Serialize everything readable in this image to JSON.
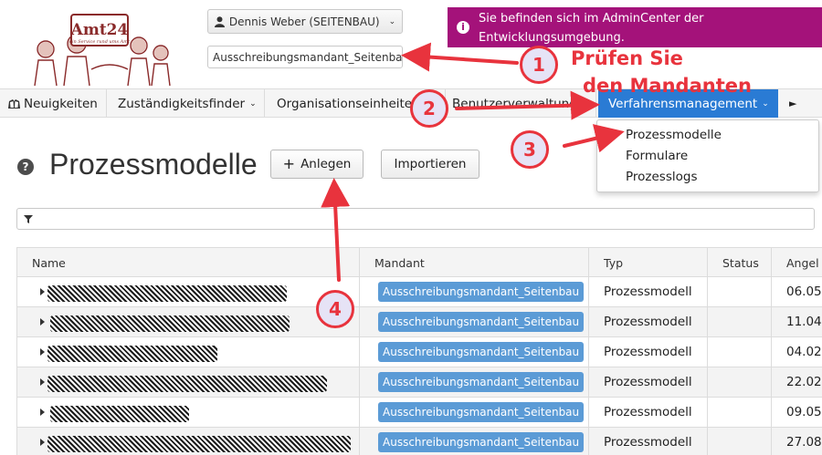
{
  "header": {
    "user_button": "Dennis Weber (SEITENBAU)",
    "mandant_select": "Ausschreibungsmandant_Seitenbau",
    "banner_text": "Sie befinden sich im AdminCenter der Entwicklungsumgebung.",
    "logo_text": "Amt24",
    "logo_tagline": "ein Service rund ums Amt"
  },
  "nav": {
    "items": [
      {
        "label": "Neuigkeiten"
      },
      {
        "label": "Zuständigkeitsfinder"
      },
      {
        "label": "Organisationseinheiten"
      },
      {
        "label": "Benutzerverwaltung"
      },
      {
        "label": "Verfahrensmanagement"
      }
    ],
    "more_symbol": "►"
  },
  "dropdown": {
    "items": [
      "Prozessmodelle",
      "Formulare",
      "Prozesslogs"
    ]
  },
  "page": {
    "title": "Prozessmodelle",
    "add_button": "Anlegen",
    "import_button": "Importieren"
  },
  "table": {
    "columns": [
      "Name",
      "Mandant",
      "Typ",
      "Status",
      "Angel"
    ],
    "rows": [
      {
        "mandant": "Ausschreibungsmandant_Seitenbau",
        "typ": "Prozessmodell",
        "status": "",
        "date": "06.05"
      },
      {
        "mandant": "Ausschreibungsmandant_Seitenbau",
        "typ": "Prozessmodell",
        "status": "",
        "date": "11.04"
      },
      {
        "mandant": "Ausschreibungsmandant_Seitenbau",
        "typ": "Prozessmodell",
        "status": "",
        "date": "04.02"
      },
      {
        "mandant": "Ausschreibungsmandant_Seitenbau",
        "typ": "Prozessmodell",
        "status": "",
        "date": "22.02"
      },
      {
        "mandant": "Ausschreibungsmandant_Seitenbau",
        "typ": "Prozessmodell",
        "status": "",
        "date": "09.05"
      },
      {
        "mandant": "Ausschreibungsmandant_Seitenbau",
        "typ": "Prozessmodell",
        "status": "",
        "date": "27.08"
      }
    ]
  },
  "annotations": {
    "num1": "1",
    "num2": "2",
    "num3": "3",
    "num4": "4",
    "text_line1": "Prüfen Sie",
    "text_line2": "den Mandanten",
    "color": "#e8333d"
  },
  "colors": {
    "banner": "#a4127a",
    "nav_active": "#2a7bd4",
    "badge": "#5b9bd6"
  }
}
